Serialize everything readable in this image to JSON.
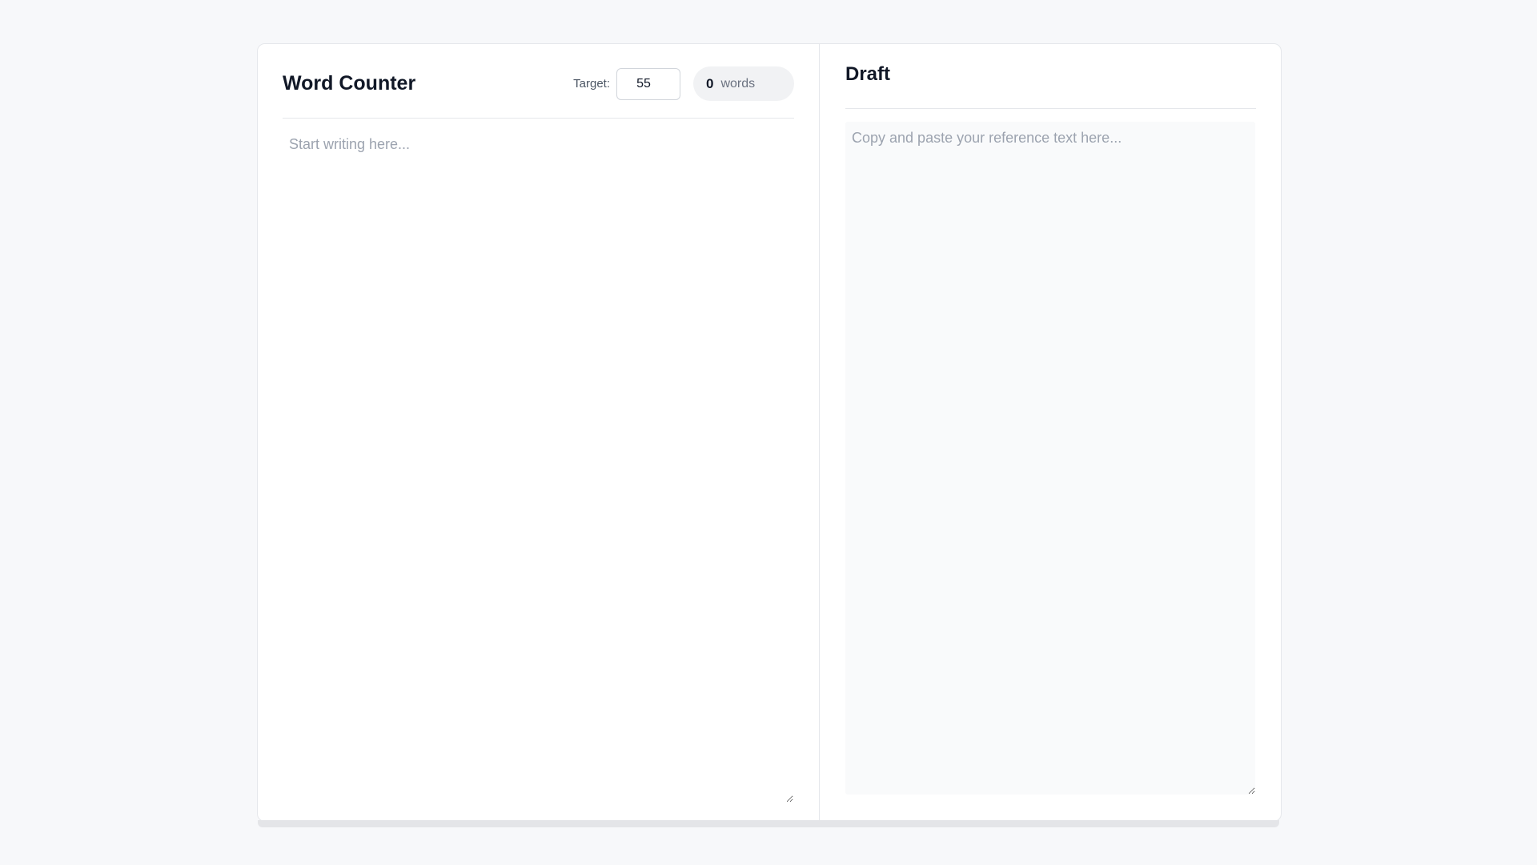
{
  "editor": {
    "title": "Word Counter",
    "target_label": "Target:",
    "target_value": "55",
    "word_count": "0",
    "word_unit": "words",
    "placeholder": "Start writing here..."
  },
  "draft": {
    "title": "Draft",
    "placeholder": "Copy and paste your reference text here..."
  },
  "colors": {
    "background": "#f7f8fa",
    "card": "#ffffff",
    "pill": "#f1f2f4",
    "reference_bg": "#f9fafb",
    "text": "#111827",
    "placeholder": "#9ca3af"
  }
}
